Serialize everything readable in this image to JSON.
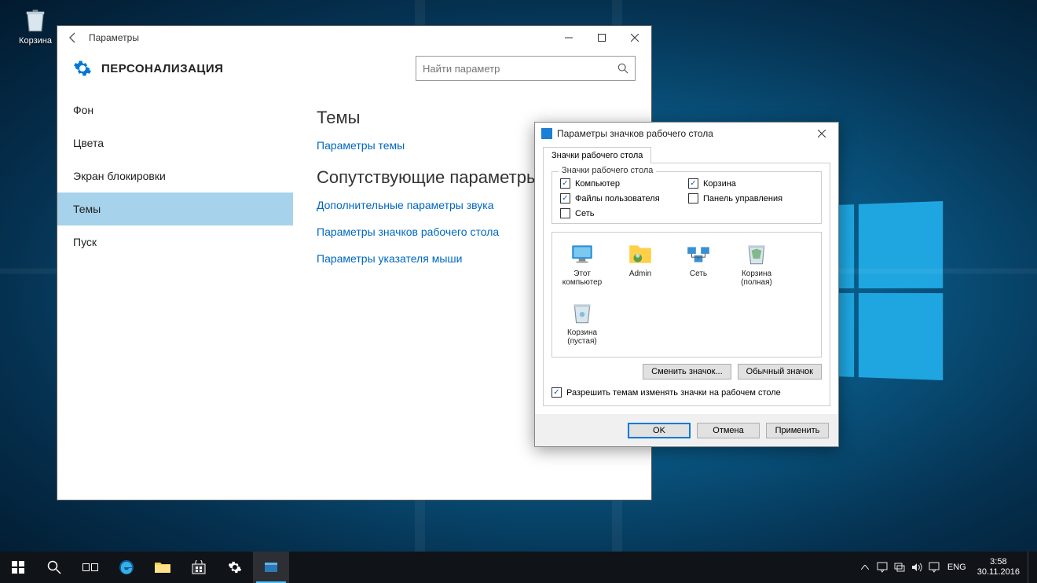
{
  "desktop": {
    "recycle_label": "Корзина"
  },
  "settings": {
    "title": "Параметры",
    "header": "ПЕРСОНАЛИЗАЦИЯ",
    "search_placeholder": "Найти параметр",
    "sidebar": [
      {
        "label": "Фон",
        "active": false
      },
      {
        "label": "Цвета",
        "active": false
      },
      {
        "label": "Экран блокировки",
        "active": false
      },
      {
        "label": "Темы",
        "active": true
      },
      {
        "label": "Пуск",
        "active": false
      }
    ],
    "content": {
      "heading1": "Темы",
      "link1": "Параметры темы",
      "heading2": "Сопутствующие параметры",
      "link2": "Дополнительные параметры звука",
      "link3": "Параметры значков рабочего стола",
      "link4": "Параметры указателя мыши"
    }
  },
  "dialog": {
    "title": "Параметры значков рабочего стола",
    "tab": "Значки рабочего стола",
    "legend": "Значки рабочего стола",
    "checks": [
      {
        "label": "Компьютер",
        "checked": true
      },
      {
        "label": "Корзина",
        "checked": true
      },
      {
        "label": "Файлы пользователя",
        "checked": true
      },
      {
        "label": "Панель управления",
        "checked": false
      },
      {
        "label": "Сеть",
        "checked": false
      }
    ],
    "icons": [
      {
        "label": "Этот компьютер"
      },
      {
        "label": "Admin"
      },
      {
        "label": "Сеть"
      },
      {
        "label": "Корзина (полная)"
      },
      {
        "label": "Корзина (пустая)"
      }
    ],
    "btn_change": "Сменить значок...",
    "btn_default": "Обычный значок",
    "allow_themes": "Разрешить темам изменять значки на рабочем столе",
    "allow_themes_checked": true,
    "ok": "OK",
    "cancel": "Отмена",
    "apply": "Применить"
  },
  "taskbar": {
    "lang": "ENG",
    "time": "3:58",
    "date": "30.11.2016"
  }
}
